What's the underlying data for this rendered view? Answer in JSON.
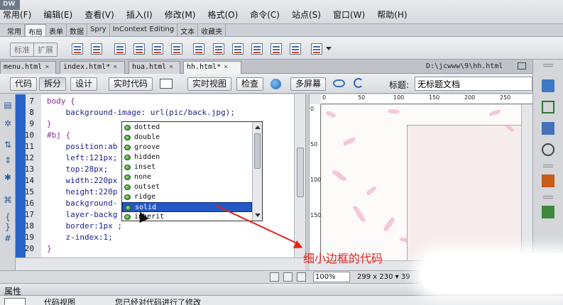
{
  "menu": {
    "logo": "DW",
    "items": [
      "常用(F)",
      "编辑(E)",
      "查看(V)",
      "插入(I)",
      "修改(M)",
      "格式(O)",
      "命令(C)",
      "站点(S)",
      "窗口(W)",
      "帮助(H)"
    ]
  },
  "insert_panel": {
    "tabs": [
      "常用",
      "布局",
      "表单",
      "数据",
      "Spry",
      "InContext Editing",
      "文本",
      "收藏夹"
    ],
    "active_tab": "布局",
    "modes": [
      "标准",
      "扩展"
    ]
  },
  "doc_tabs": {
    "tabs": [
      "menu.html",
      "index.html*",
      "hua.html",
      "hh.html*"
    ],
    "active": "hh.html*",
    "close_glyph": "×",
    "path": "D:\\jcwww\\9\\hh.html"
  },
  "doc_toolbar": {
    "code_label": "代码",
    "split_label": "拆分",
    "design_label": "设计",
    "live_code_label": "实时代码",
    "live_view_label": "实时视图",
    "inspect_label": "检查",
    "multiscreen_label": "多屏幕",
    "title_label": "标题:",
    "title_value": "无标题文档"
  },
  "code": {
    "lines": [
      {
        "num": "7",
        "text": "body {",
        "kind": "sel"
      },
      {
        "num": "8",
        "text": "    background-image: url(pic/back.jpg);",
        "kind": "prop"
      },
      {
        "num": "9",
        "text": "}",
        "kind": "brace"
      },
      {
        "num": "10",
        "text": "#bj {",
        "kind": "sel"
      },
      {
        "num": "11",
        "text": "    position:ab",
        "kind": "prop"
      },
      {
        "num": "12",
        "text": "    left:121px;",
        "kind": "prop"
      },
      {
        "num": "13",
        "text": "    top:28px;",
        "kind": "prop"
      },
      {
        "num": "14",
        "text": "    width:220px",
        "kind": "prop"
      },
      {
        "num": "15",
        "text": "    height:220p",
        "kind": "prop"
      },
      {
        "num": "16",
        "text": "    background-",
        "kind": "prop"
      },
      {
        "num": "17",
        "text": "    layer-backg",
        "kind": "prop"
      },
      {
        "num": "18",
        "text": "    border:1px ;",
        "kind": "prop"
      },
      {
        "num": "19",
        "text": "    z-index:1;",
        "kind": "prop"
      },
      {
        "num": "20",
        "text": "}",
        "kind": "brace"
      }
    ]
  },
  "autocomplete": {
    "items": [
      "dotted",
      "double",
      "groove",
      "hidden",
      "inset",
      "none",
      "outset",
      "ridge",
      "solid",
      "inherit"
    ],
    "selected": "solid"
  },
  "rulers": {
    "top": [
      "0",
      "50",
      "100",
      "150",
      "200",
      "250"
    ],
    "left": [
      "0",
      "50",
      "100",
      "150"
    ]
  },
  "status_bar": {
    "zoom": "100%",
    "size": "299 x 230",
    "extra": "39"
  },
  "properties": {
    "title": "属性",
    "view_label": "代码视图",
    "message": "您已经对代码进行了修改"
  },
  "annotation": {
    "text": "细小边框的代码",
    "color": "#e0241b"
  },
  "colors": {
    "gutter_bar": "#2a62c8",
    "selection": "#2458c6"
  }
}
